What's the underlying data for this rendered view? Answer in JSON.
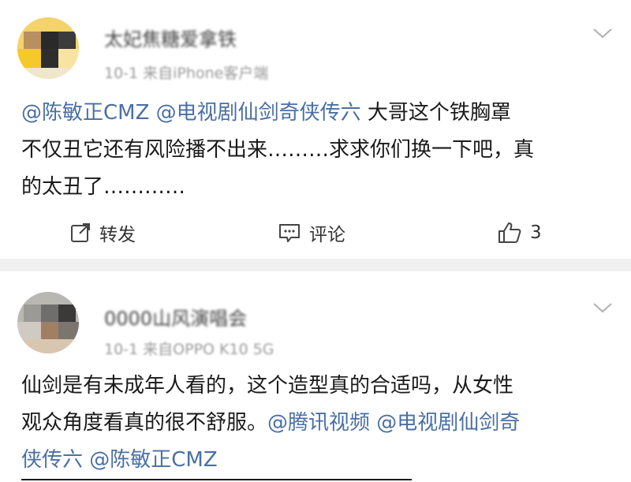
{
  "posts": [
    {
      "username": "太妃焦糖爱拿铁",
      "meta": "10-1 来自iPhone客户端",
      "content_mentions_1": "@陈敏正CMZ @电视剧仙剑奇侠传六",
      "content_line1_text": " 大哥这个铁胸罩",
      "content_line2": "不仅丑它还有风险播不出来………求求你们换一下吧，真",
      "content_line3": "的太丑了…………",
      "actions": {
        "repost_label": "转发",
        "comment_label": "评论",
        "like_count": "3"
      }
    },
    {
      "username": "0000山风演唱会",
      "meta": "10-1 来自OPPO K10 5G",
      "content_line1": "仙剑是有未成年人看的，这个造型真的合适吗，从女性",
      "content_line2_text": "观众角度看真的很不舒服。",
      "content_line2_mentions": "@腾讯视频 @电视剧仙剑奇",
      "content_line3_mentions": "侠传六 @陈敏正CMZ"
    }
  ],
  "colors": {
    "mention": "#4a6fa5",
    "text": "#1a1a1a",
    "meta": "#9a9a9a",
    "divider_band": "#f1f1f1"
  },
  "icons": [
    "chevron-down-icon",
    "repost-icon",
    "comment-icon",
    "like-icon"
  ]
}
